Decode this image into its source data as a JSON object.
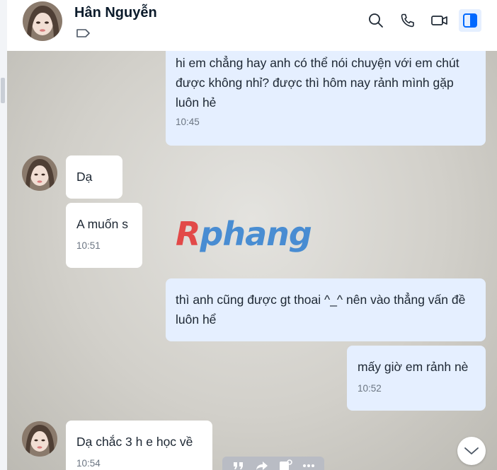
{
  "contact": {
    "name": "Hân Nguyễn"
  },
  "header_actions": [
    "search-icon",
    "phone-icon",
    "video-call-icon",
    "conversation-info-icon"
  ],
  "messages": [
    {
      "direction": "outgoing",
      "text": "hi em chẳng hay anh có thể nói chuyện với em chút được không nhỉ? được thì hôm nay rảnh mình gặp luôn hẻ",
      "time": "10:45"
    },
    {
      "direction": "incoming",
      "text": "Dạ",
      "time": ""
    },
    {
      "direction": "incoming",
      "text": "A muốn s",
      "time": "10:51"
    },
    {
      "direction": "outgoing",
      "text": "thì anh cũng được gt thoai ^_^ nên vào thẳng vấn đề luôn hể",
      "time": ""
    },
    {
      "direction": "outgoing",
      "text": "mấy giờ em rảnh nè",
      "time": "10:52"
    },
    {
      "direction": "incoming",
      "text": "Dạ chắc 3 h e học về",
      "time": "10:54"
    }
  ],
  "watermark": {
    "first": "R",
    "rest": "phang"
  },
  "colors": {
    "outgoing_bubble": "#e5efff",
    "incoming_bubble": "#ffffff",
    "accent": "#0068ff"
  }
}
